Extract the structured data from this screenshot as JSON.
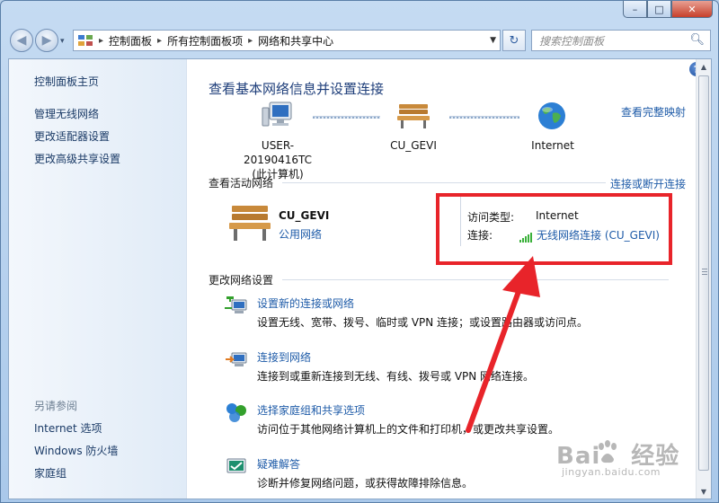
{
  "titlebar": {
    "min": "–",
    "max": "□",
    "close": "✕"
  },
  "navbar": {
    "back": "◀",
    "forward": "▶",
    "recent": "▾",
    "breadcrumbs": [
      "控制面板",
      "所有控制面板项",
      "网络和共享中心"
    ],
    "breadcrumb_sep": "▸",
    "dropdown": "▼",
    "refresh": "↻",
    "search_placeholder": "搜索控制面板",
    "search_icon": "search-icon"
  },
  "sidebar": {
    "home": "控制面板主页",
    "links": [
      "管理无线网络",
      "更改适配器设置",
      "更改高级共享设置"
    ],
    "see_also_heading": "另请参阅",
    "see_also": [
      "Internet 选项",
      "Windows 防火墙",
      "家庭组"
    ]
  },
  "main": {
    "help": "?",
    "title": "查看基本网络信息并设置连接",
    "full_map": "查看完整映射",
    "map": {
      "computer_name": "USER-20190416TC",
      "computer_sub": "(此计算机)",
      "network": "CU_GEVI",
      "internet": "Internet"
    },
    "active_heading": "查看活动网络",
    "connect_disconnect": "连接或断开连接",
    "active": {
      "name": "CU_GEVI",
      "type": "公用网络",
      "access_label": "访问类型:",
      "access_value": "Internet",
      "conn_label": "连接:",
      "conn_value": "无线网络连接 (CU_GEVI)"
    },
    "change_heading": "更改网络设置",
    "tasks": [
      {
        "link": "设置新的连接或网络",
        "desc": "设置无线、宽带、拨号、临时或 VPN 连接；或设置路由器或访问点。"
      },
      {
        "link": "连接到网络",
        "desc": "连接到或重新连接到无线、有线、拨号或 VPN 网络连接。"
      },
      {
        "link": "选择家庭组和共享选项",
        "desc": "访问位于其他网络计算机上的文件和打印机，或更改共享设置。"
      },
      {
        "link": "疑难解答",
        "desc": "诊断并修复网络问题，或获得故障排除信息。"
      }
    ]
  },
  "watermark": {
    "brand_left": "Bai",
    "brand_right": "经验",
    "url": "jingyan.baidu.com"
  },
  "colors": {
    "link": "#1e5ba8",
    "annotation_red": "#e8242a",
    "signal_green": "#3bb13b"
  }
}
